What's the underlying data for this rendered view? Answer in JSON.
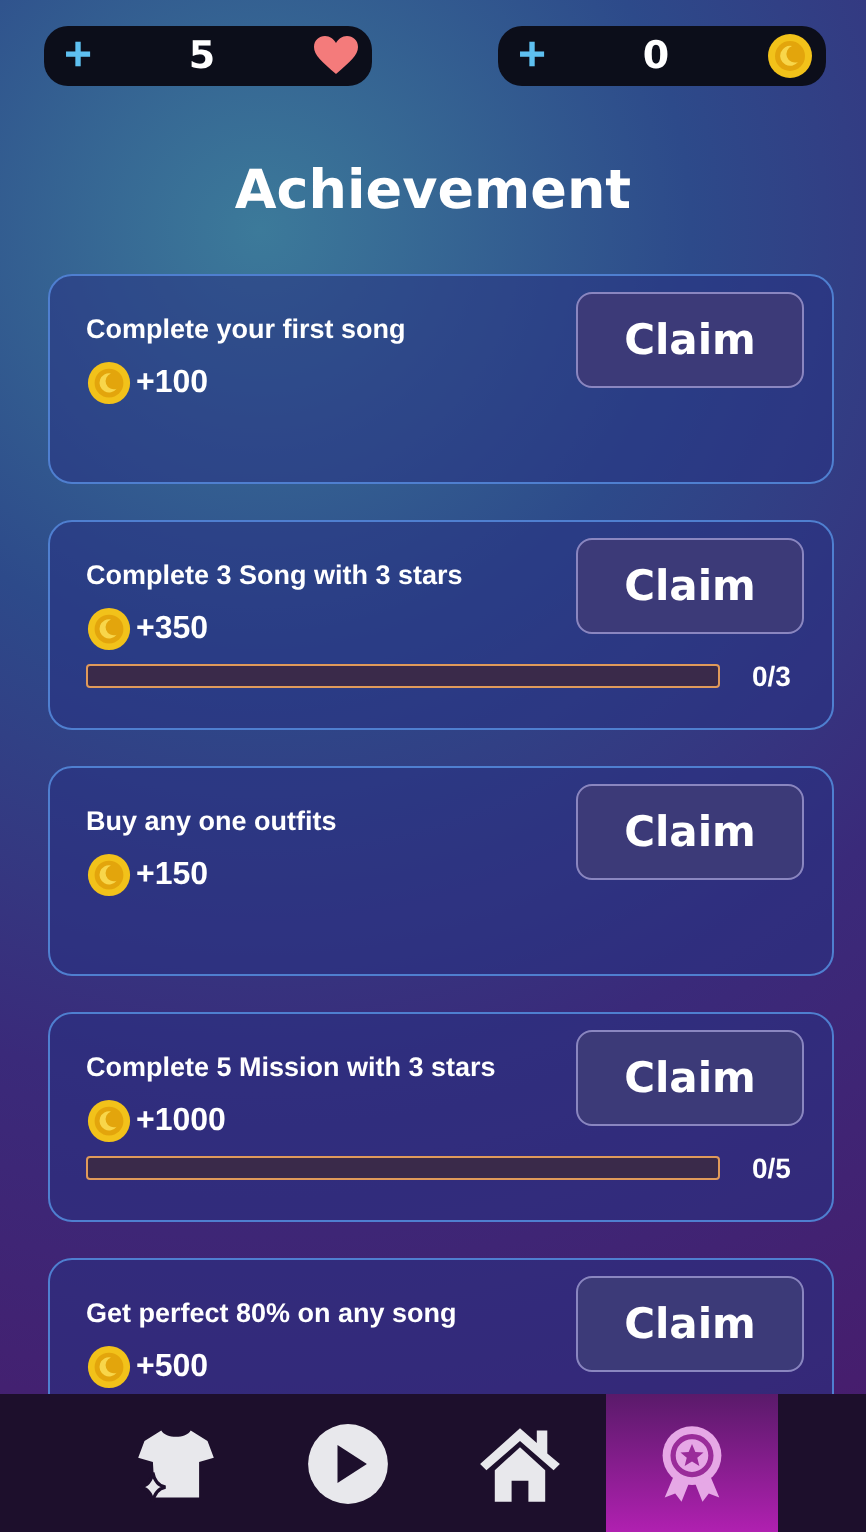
{
  "top_bar": {
    "lives": {
      "plus": "+",
      "value": "5"
    },
    "coins": {
      "plus": "+",
      "value": "0"
    }
  },
  "title": "Achievement",
  "achievements": [
    {
      "kind": "simple",
      "title": "Complete your first song",
      "reward": "+100",
      "button": "Claim"
    },
    {
      "kind": "progress",
      "title": "Complete 3 Song with 3 stars",
      "reward": "+350",
      "button": "Claim",
      "level": 0,
      "progress": "0/3"
    },
    {
      "kind": "simple",
      "title": "Buy any one outfits",
      "reward": "+150",
      "button": "Claim"
    },
    {
      "kind": "progress",
      "title": "Complete 5 Mission with 3 stars",
      "reward": "+1000",
      "button": "Claim",
      "level": 0,
      "progress": "0/5"
    },
    {
      "kind": "simple",
      "title": "Get perfect 80% on any song",
      "reward": "+500",
      "button": "Claim"
    }
  ],
  "nav": [
    {
      "kind": "outfits",
      "selected": false
    },
    {
      "kind": "play",
      "selected": false
    },
    {
      "kind": "home",
      "selected": false
    },
    {
      "kind": "achievements",
      "selected": true
    }
  ]
}
